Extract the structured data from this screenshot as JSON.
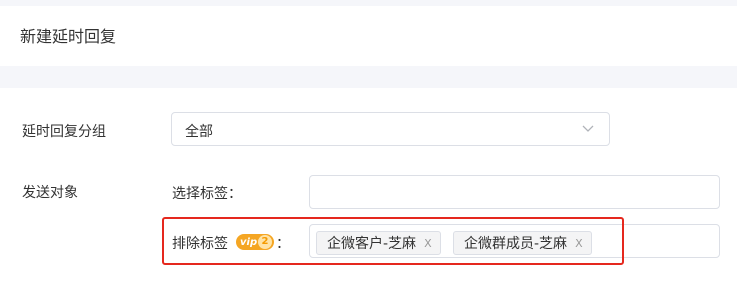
{
  "page": {
    "title": "新建延时回复"
  },
  "form": {
    "group": {
      "label": "延时回复分组",
      "selected": "全部"
    },
    "target": {
      "label": "发送对象",
      "select_tags_label": "选择标签：",
      "exclude_tags_label": "排除标签",
      "exclude_suffix": "：",
      "vip_text": "vip",
      "vip_level": "2",
      "excluded_tags": [
        {
          "label": "企微客户-芝麻",
          "close": "X"
        },
        {
          "label": "企微群成员-芝麻",
          "close": "X"
        }
      ]
    }
  },
  "colors": {
    "highlight": "#e5281e",
    "vip": "#f5a623",
    "border": "#dcdfe6"
  }
}
